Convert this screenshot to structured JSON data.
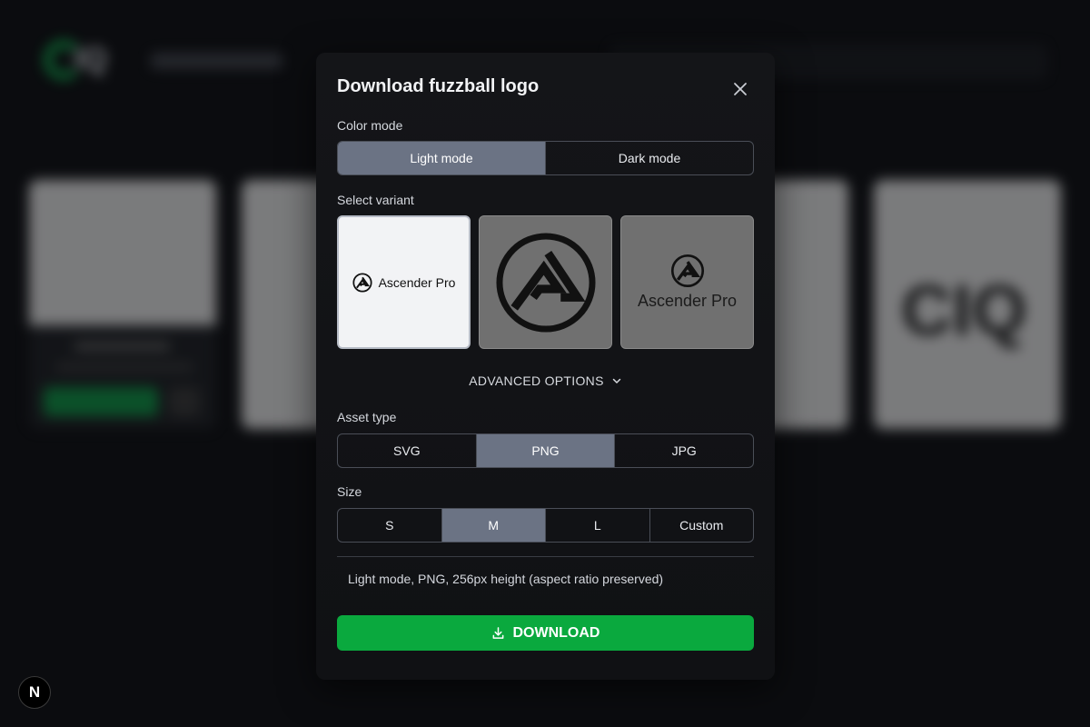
{
  "background": {
    "logo_text": "IQ"
  },
  "dialog": {
    "title": "Download fuzzball logo",
    "close_icon": "close-icon",
    "color_mode": {
      "label": "Color mode",
      "options": [
        "Light mode",
        "Dark mode"
      ],
      "selected": "Light mode"
    },
    "variant": {
      "label": "Select variant",
      "items": [
        {
          "text": "Ascender Pro",
          "kind": "horizontal-wordmark",
          "selected": true
        },
        {
          "text": "",
          "kind": "symbol-only",
          "selected": false
        },
        {
          "text": "Ascender Pro",
          "kind": "stacked-wordmark",
          "selected": false
        }
      ]
    },
    "advanced": {
      "label": "ADVANCED OPTIONS",
      "icon": "chevron-down-icon"
    },
    "asset_type": {
      "label": "Asset type",
      "options": [
        "SVG",
        "PNG",
        "JPG"
      ],
      "selected": "PNG"
    },
    "size": {
      "label": "Size",
      "options": [
        "S",
        "M",
        "L",
        "Custom"
      ],
      "selected": "M"
    },
    "summary": "Light mode, PNG, 256px height (aspect ratio preserved)",
    "download": {
      "label": "DOWNLOAD",
      "icon": "download-icon"
    }
  },
  "dev_badge": {
    "label": "N"
  },
  "colors": {
    "accent_green": "#0aa93e",
    "selected_segment": "#6b7384",
    "dialog_bg": "#141518"
  }
}
